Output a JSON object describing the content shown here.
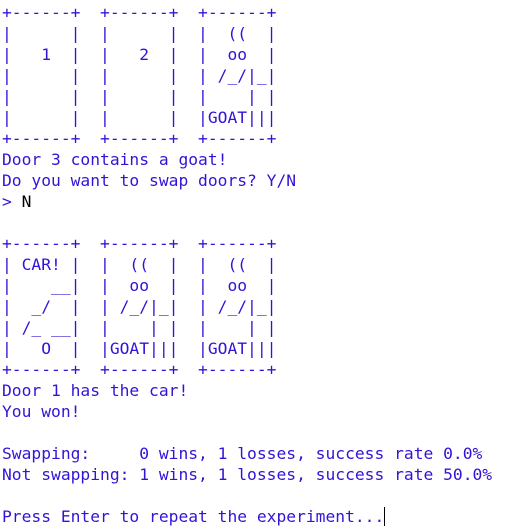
{
  "colors": {
    "output": "#3214d6",
    "input": "#000000"
  },
  "terminal": {
    "round1_doors": [
      "+------+  +------+  +------+",
      "|      |  |      |  |  ((  |",
      "|   1  |  |   2  |  |  oo  |",
      "|      |  |      |  | /_/|_|",
      "|      |  |      |  |    | |",
      "|      |  |      |  |GOAT|||",
      "+------+  +------+  +------+"
    ],
    "reveal_message": "Door 3 contains a goat!",
    "swap_prompt": "Do you want to swap doors? Y/N",
    "prompt_symbol": "> ",
    "user_input": "N",
    "round2_doors": [
      "+------+  +------+  +------+",
      "| CAR! |  |  ((  |  |  ((  |",
      "|    __|  |  oo  |  |  oo  |",
      "|  _/  |  | /_/|_|  | /_/|_|",
      "| /_ __|  |    | |  |    | |",
      "|   O  |  |GOAT|||  |GOAT|||",
      "+------+  +------+  +------+"
    ],
    "car_message": "Door 1 has the car!",
    "result_message": "You won!",
    "stats_swapping": "Swapping:     0 wins, 1 losses, success rate 0.0%",
    "stats_not_swapping": "Not swapping: 1 wins, 1 losses, success rate 50.0%",
    "continue_prompt": "Press Enter to repeat the experiment..."
  }
}
